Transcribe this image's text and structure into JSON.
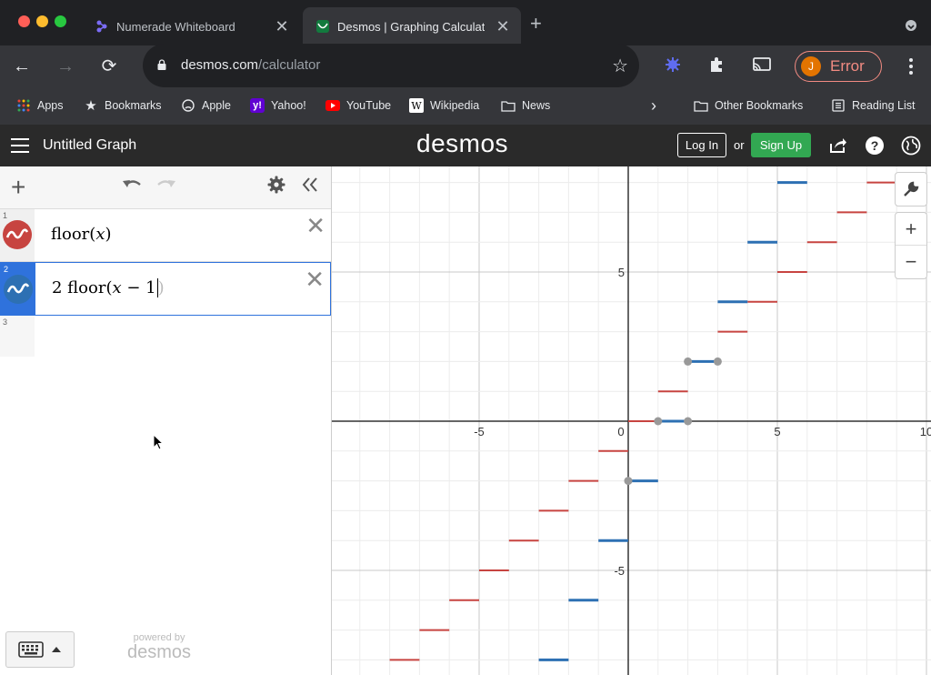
{
  "browser": {
    "tabs": [
      {
        "title": "Numerade Whiteboard",
        "active": false
      },
      {
        "title": "Desmos | Graphing Calculato",
        "active": true
      }
    ],
    "url": {
      "host": "desmos.com",
      "path": "/calculator"
    },
    "profile": {
      "initial": "J",
      "label": "Error"
    },
    "bookmarks": [
      "Apps",
      "Bookmarks",
      "Apple",
      "Yahoo!",
      "YouTube",
      "Wikipedia",
      "News"
    ],
    "bookmarks_right": [
      "Other Bookmarks",
      "Reading List"
    ]
  },
  "app": {
    "graph_title": "Untitled Graph",
    "logo": "desmos",
    "login_label": "Log In",
    "or_label": "or",
    "signup_label": "Sign Up"
  },
  "expressions": [
    {
      "index": "1",
      "latex_text": "floor(",
      "var": "x",
      "close": ")",
      "color": "#c74440"
    },
    {
      "index": "2",
      "latex_text": "2 floor(",
      "var": "x",
      "rest": " − 1",
      "close": ")",
      "color": "#2d70b3"
    },
    {
      "index": "3"
    }
  ],
  "powered_by": {
    "line1": "powered by",
    "line2": "desmos"
  },
  "chart_data": {
    "type": "line",
    "xlim": [
      -10,
      10
    ],
    "ylim": [
      -8,
      8.2
    ],
    "grid": true,
    "x_ticks": [
      "-5",
      "0",
      "5",
      "10"
    ],
    "y_ticks": [
      "5",
      "-5"
    ],
    "series": [
      {
        "color": "#c74440",
        "function": "floor(x)",
        "steps_from": -8,
        "steps_to": 9
      },
      {
        "color": "#2d70b3",
        "function": "2 floor(x - 1)",
        "steps_from": -3,
        "steps_to": 6
      }
    ],
    "points": [
      [
        0,
        -2
      ],
      [
        1,
        0
      ],
      [
        2,
        0
      ],
      [
        2,
        2
      ],
      [
        3,
        2
      ]
    ]
  }
}
